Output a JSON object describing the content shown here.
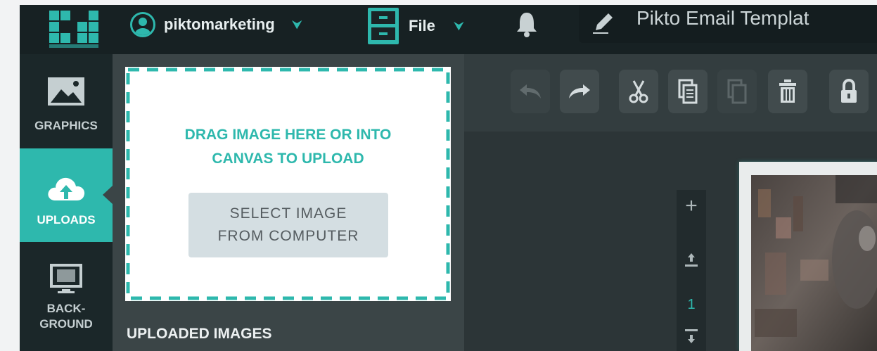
{
  "topbar": {
    "account_name": "piktomarketing",
    "file_label": "File",
    "document_title": "Pikto Email Templat",
    "icons": [
      "logo",
      "user-avatar-icon",
      "chevron-down-icon",
      "file-cabinet-icon",
      "bell-icon",
      "pencil-icon"
    ]
  },
  "nav": {
    "graphics": "GRAPHICS",
    "uploads": "UPLOADS",
    "background_line1": "BACK-",
    "background_line2": "GROUND"
  },
  "upload_panel": {
    "drop_line1": "DRAG IMAGE HERE OR INTO",
    "drop_line2": "CANVAS TO UPLOAD",
    "select_line1": "SELECT IMAGE",
    "select_line2": "FROM COMPUTER",
    "uploaded_title": "UPLOADED IMAGES"
  },
  "toolbar": {
    "buttons": [
      "undo",
      "redo",
      "cut",
      "copy",
      "paste",
      "delete",
      "lock"
    ]
  },
  "pages": {
    "add_symbol": "+",
    "current_page": "1"
  },
  "colors": {
    "accent": "#2eb8ad",
    "topbar_bg": "#172123",
    "panel_bg": "#3b4547",
    "select_button_bg": "#d4dee2"
  }
}
